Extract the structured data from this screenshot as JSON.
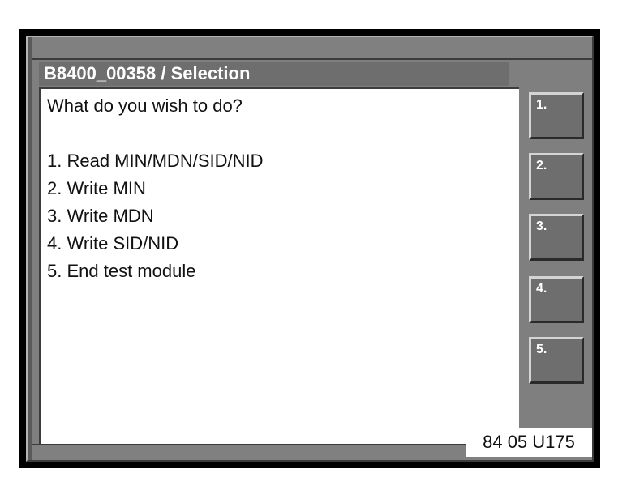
{
  "window": {
    "title": "B8400_00358 / Selection"
  },
  "content": {
    "prompt": "What do you wish to do?",
    "options": [
      "1. Read MIN/MDN/SID/NID",
      "2. Write MIN",
      "3. Write MDN",
      "4. Write SID/NID",
      "5. End test module"
    ]
  },
  "soft_keys": [
    {
      "label": "1."
    },
    {
      "label": "2."
    },
    {
      "label": "3."
    },
    {
      "label": "4."
    },
    {
      "label": "5."
    }
  ],
  "reference_label": "84 05 U175",
  "colors": {
    "panel": "#7f7f7f",
    "title_bar": "#6e6e6e",
    "content_bg": "#ffffff",
    "key_face": "#6e6e6e"
  }
}
